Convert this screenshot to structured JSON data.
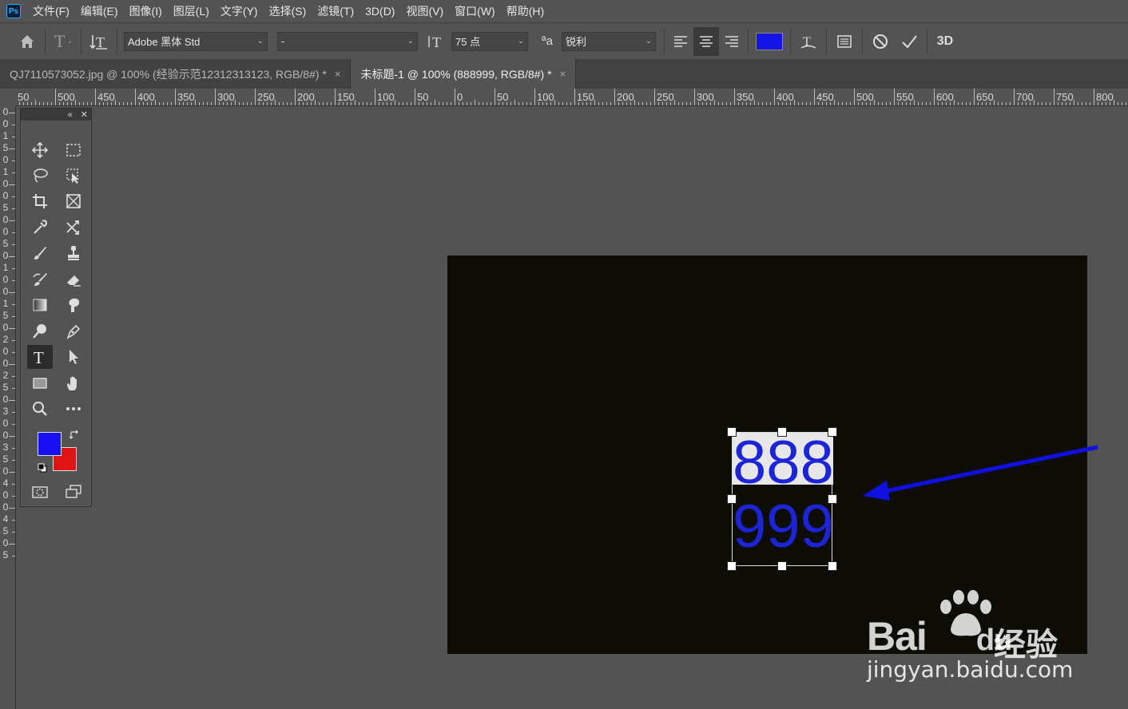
{
  "app": {
    "logo": "Ps"
  },
  "menu": [
    "文件(F)",
    "编辑(E)",
    "图像(I)",
    "图层(L)",
    "文字(Y)",
    "选择(S)",
    "滤镜(T)",
    "3D(D)",
    "视图(V)",
    "窗口(W)",
    "帮助(H)"
  ],
  "options": {
    "font_family": "Adobe 黑体 Std",
    "font_style": "-",
    "font_size": "75 点",
    "aa_label": "ªa",
    "antialias": "锐利",
    "text_color": "#1414e6",
    "threed_label": "3D"
  },
  "tabs": [
    {
      "title": "QJ7110573052.jpg @ 100% (经验示范12312313123, RGB/8#) *",
      "close": "×"
    },
    {
      "title": "未标题-1 @ 100% (888999, RGB/8#) *",
      "close": "×"
    }
  ],
  "ruler_top": [
    "50",
    "500",
    "450",
    "400",
    "350",
    "300",
    "250",
    "200",
    "150",
    "100",
    "50",
    "0",
    "50",
    "100",
    "150",
    "200",
    "250",
    "300",
    "350",
    "400",
    "450",
    "500",
    "550",
    "600",
    "650",
    "700",
    "750",
    "800"
  ],
  "ruler_left": [
    "0",
    "0",
    "1",
    "5",
    "0",
    "1",
    "0",
    "0",
    "5",
    "0",
    "0",
    "5",
    "0",
    "1",
    "0",
    "0",
    "1",
    "5",
    "0",
    "2",
    "0",
    "0",
    "2",
    "5",
    "0",
    "3",
    "0",
    "0",
    "3",
    "5",
    "0",
    "4",
    "0",
    "0",
    "4",
    "5",
    "0",
    "5"
  ],
  "toolbox": {
    "collapse": "«",
    "close": "✕"
  },
  "colors": {
    "foreground": "#1a0ff0",
    "background": "#e01414",
    "canvas": "#0d0d05",
    "arrow": "#1010e0",
    "text": "#1c24d6"
  },
  "canvas": {
    "line1": "888",
    "line2": "999"
  },
  "watermark": {
    "logo": "Bai",
    "logo2": "du",
    "cn": "经验",
    "url": "jingyan.baidu.com"
  }
}
